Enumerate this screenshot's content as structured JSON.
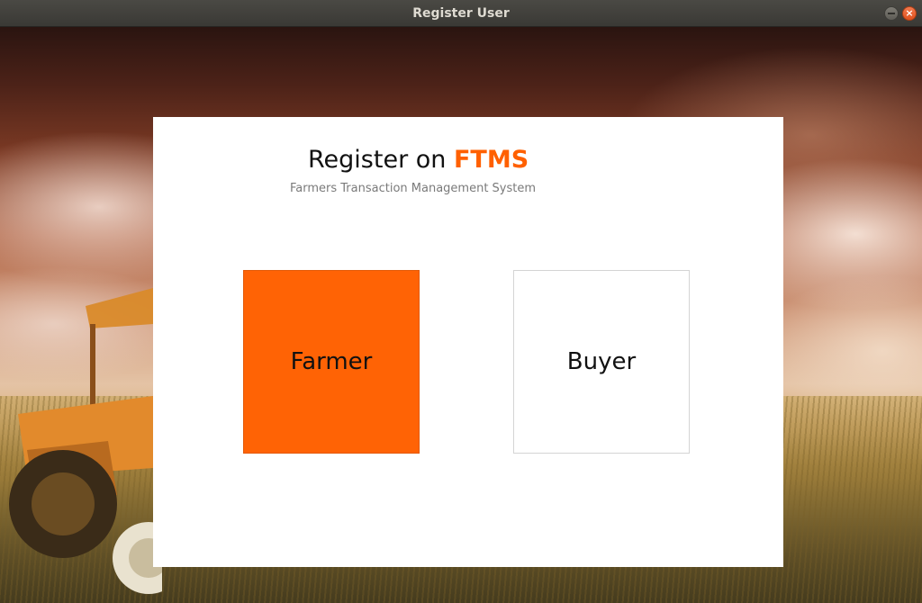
{
  "window": {
    "title": "Register User",
    "controls": {
      "minimize_icon": "minimize-icon",
      "close_icon": "close-icon",
      "close_glyph": "×"
    }
  },
  "header": {
    "prefix": "Register on",
    "brand": "FTMS",
    "subtitle": "Farmers Transaction Management System"
  },
  "roles": {
    "farmer_label": "Farmer",
    "buyer_label": "Buyer"
  },
  "colors": {
    "accent": "#ff6305",
    "brand_text": "#ff6000",
    "panel_background": "#ffffff",
    "close_button": "#e95420"
  }
}
